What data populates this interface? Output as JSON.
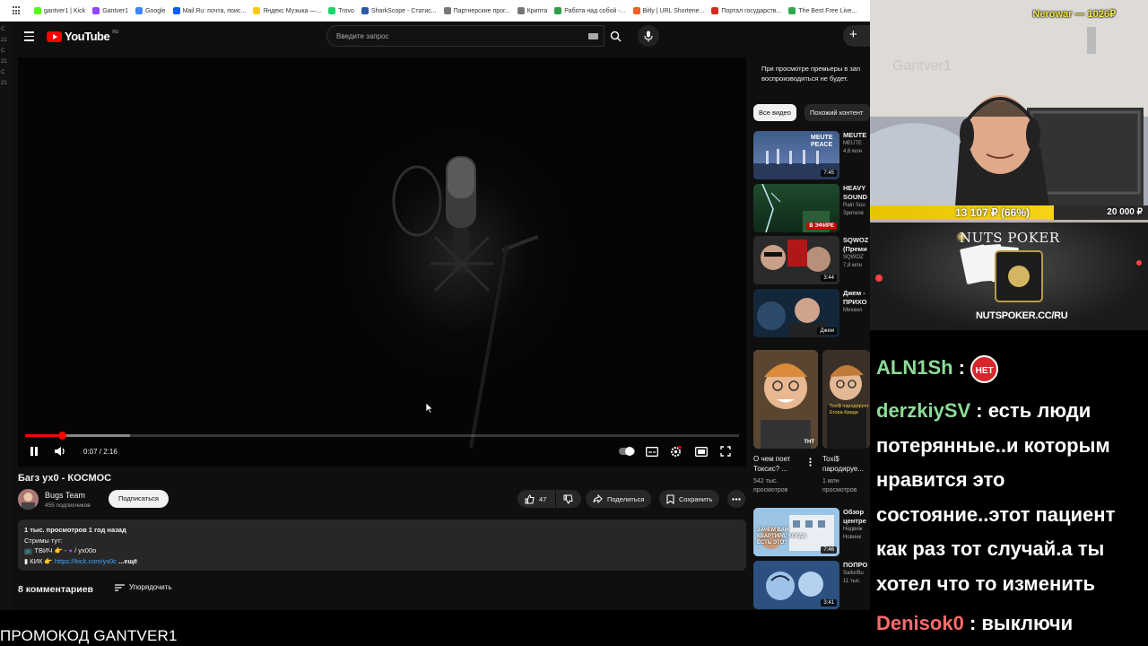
{
  "browser": {
    "bookmarks": [
      {
        "label": "gantver1 | Kick",
        "color": "#53fc18"
      },
      {
        "label": "Gantver1",
        "color": "#9146ff"
      },
      {
        "label": "Google",
        "color": "#4285f4"
      },
      {
        "label": "Mail.Ru: почта, поис...",
        "color": "#005ff9"
      },
      {
        "label": "Яндекс Музыка —...",
        "color": "#ffcc00"
      },
      {
        "label": "Trovo",
        "color": "#19d66b"
      },
      {
        "label": "SharkScope - Статис...",
        "color": "#2b5aa6"
      },
      {
        "label": "Партнерские прог...",
        "color": "#777777"
      },
      {
        "label": "Крипта",
        "color": "#777777"
      },
      {
        "label": "Работа над собой -...",
        "color": "#2e9e44"
      },
      {
        "label": "Bitly | URL Shortene...",
        "color": "#ee6123"
      },
      {
        "label": "Портал государств...",
        "color": "#d52b1e"
      },
      {
        "label": "The Best Free Live...",
        "color": "#2fa84f"
      }
    ]
  },
  "left_strip": [
    "C",
    "21",
    "C",
    "21",
    "C",
    "21"
  ],
  "youtube": {
    "logo_text": "YouTube",
    "logo_region": "RU",
    "search_placeholder": "Введите запрос",
    "player": {
      "elapsed": "0:07",
      "duration": "2:16",
      "time_separator": " / ",
      "progress_fraction": 0.052,
      "buffered_fraction": 0.147
    },
    "video_title": "Багз ух0 - КОСМОС",
    "channel": {
      "name": "Bugs Team",
      "subscribers": "455 подписчиков",
      "subscribe_label": "Подписаться"
    },
    "actions": {
      "likes": "47",
      "share_label": "Поделиться",
      "save_label": "Сохранить"
    },
    "description": {
      "stats": "1 тыс. просмотров  1 год назад",
      "line1": "Стримы тут:",
      "line2_prefix": "📺 ТВИЧ 👉 - ",
      "line2_suffix": " / yx00o",
      "line3_prefix": "▮ КИК 👉 ",
      "line3_link": "https://kick.com/yx0c",
      "more_label": "...ещё"
    },
    "comments": {
      "count_label": "8 комментариев",
      "sort_label": "Упорядочить"
    },
    "sidebar": {
      "premiere_note": [
        "При просмотре премьеры в зап",
        "воспроизводиться не будет."
      ],
      "chips": [
        "Все видео",
        "Похожий контент"
      ],
      "videos": [
        {
          "title1": "MEUTE",
          "title2": "",
          "channel": "MEUTE",
          "meta": "4,6 млн",
          "badge": "7:45",
          "live": false,
          "thumb_text": "MEUTE PEACE"
        },
        {
          "title1": "HEAVY",
          "title2": "SOUND",
          "channel": "Rain Sou",
          "meta": "Зрителе",
          "badge": "В ЭФИРЕ",
          "live": true,
          "thumb_text": ""
        },
        {
          "title1": "SQWOZ",
          "title2": "(Преми",
          "channel": "SQWOZ",
          "meta": "7,8 млн",
          "badge": "3:44",
          "live": false,
          "thumb_text": ""
        },
        {
          "title1": "Джем -",
          "title2": "ПРИХО",
          "channel": "Михаил",
          "meta": "",
          "badge": "Джем",
          "live": false,
          "thumb_text": ""
        }
      ],
      "shorts": [
        {
          "title1": "О чем поет",
          "title2": "Токсис? ...",
          "views1": "542 тыс.",
          "views2": "просмотров",
          "thumb_text": "ТНТ"
        },
        {
          "title1": "Toxi$",
          "title2": "пародируе...",
          "views1": "1 млн",
          "views2": "просмотров",
          "thumb_text": "Toxi$ пародирует Егора Крида"
        }
      ],
      "videos2": [
        {
          "title1": "Обзор",
          "title2": "центре",
          "channel": "Недвиж",
          "meta": "Новинк",
          "badge": "7:46",
          "thumb_text": "ЗАЧЕМ ВАМ КВАРТИРА, КОГДА ЕСТЬ ЭТО?"
        },
        {
          "title1": "ПОПРО",
          "title2": "",
          "channel": "SailorBu",
          "meta": "11 тыс.",
          "badge": "3:41",
          "thumb_text": ""
        }
      ]
    }
  },
  "overlay": {
    "cam_label": "Nerowar — 1026₽",
    "cam_watermark": "Gantver1",
    "goal_progress": "13 107 ₽ (66%)",
    "goal_fraction": 0.66,
    "goal_target": "20 000 ₽",
    "ad_brand": "NUTS POKER",
    "ad_url": "NUTSPOKER.CC/RU",
    "chat": [
      {
        "nick": "ALN1Sh",
        "sep": " : ",
        "text": "",
        "badge": "НЕТ",
        "color": "#8ddb98"
      },
      {
        "nick": "derzkiySV",
        "sep": " : ",
        "text": "есть люди потерянные..и которым нравится это состояние..этот пациент как раз тот случай.а ты хотел что то изменить",
        "color": "#8ddb98"
      },
      {
        "nick": "Denisok0",
        "sep": " : ",
        "text": "выключи",
        "color": "#ff6b6b"
      }
    ],
    "promo": "ПРОМОКОД GANTVER1"
  }
}
